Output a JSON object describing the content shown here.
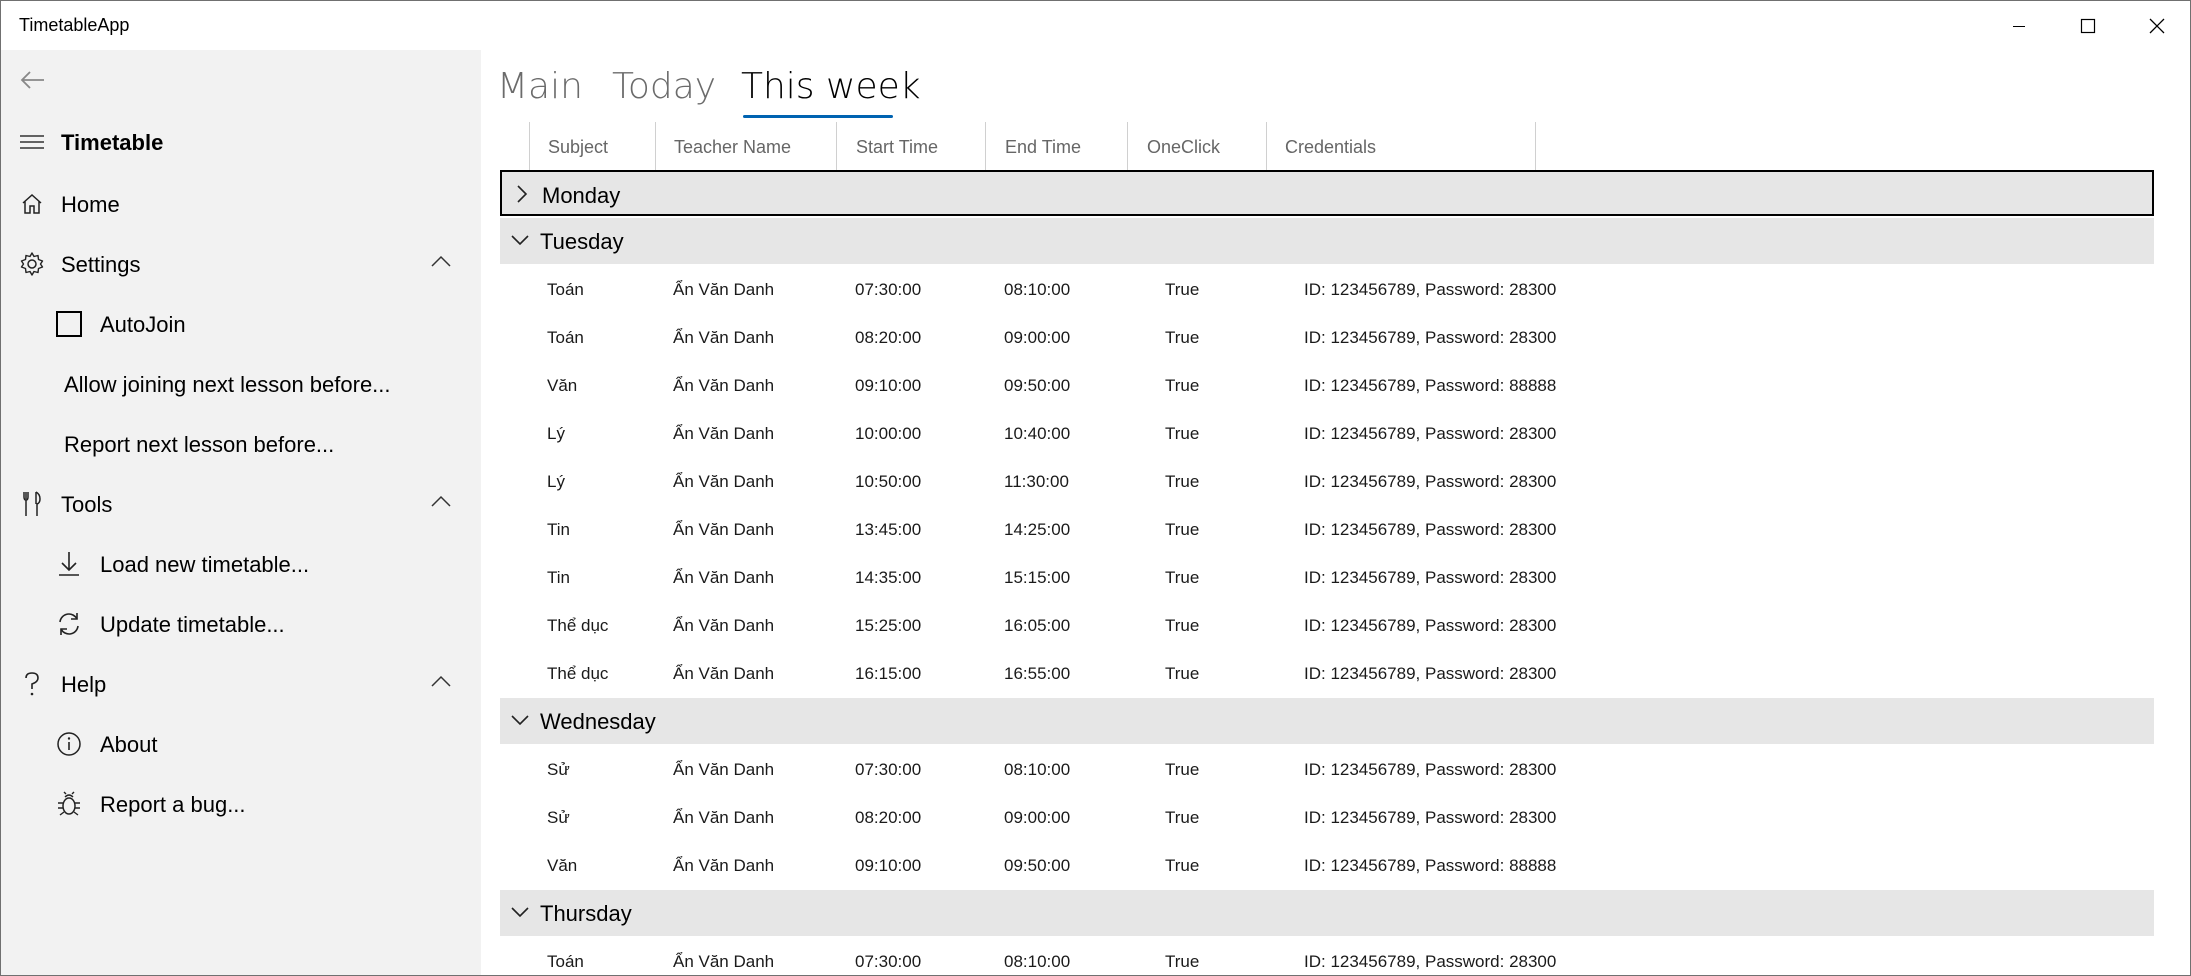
{
  "window": {
    "title": "TimetableApp"
  },
  "sidebar": {
    "title": "Timetable",
    "home": "Home",
    "settings": {
      "label": "Settings",
      "autojoin": "AutoJoin",
      "allow_joining": "Allow joining next lesson before...",
      "report_next": "Report next lesson before..."
    },
    "tools": {
      "label": "Tools",
      "load": "Load new timetable...",
      "update": "Update timetable..."
    },
    "help": {
      "label": "Help",
      "about": "About",
      "report_bug": "Report a bug..."
    }
  },
  "tabs": {
    "main": "Main",
    "today": "Today",
    "this_week": "This week",
    "selected": "This week"
  },
  "columns": {
    "subject": "Subject",
    "teacher": "Teacher Name",
    "start": "Start Time",
    "end": "End Time",
    "oneclick": "OneClick",
    "credentials": "Credentials"
  },
  "groups": {
    "monday": {
      "day": "Monday",
      "expanded": false,
      "rows": []
    },
    "tuesday": {
      "day": "Tuesday",
      "expanded": true,
      "rows": [
        {
          "subject": "Toán",
          "teacher": "Ẩn Văn Danh",
          "start": "07:30:00",
          "end": "08:10:00",
          "oneclick": "True",
          "credentials": "ID: 123456789, Password: 28300"
        },
        {
          "subject": "Toán",
          "teacher": "Ẩn Văn Danh",
          "start": "08:20:00",
          "end": "09:00:00",
          "oneclick": "True",
          "credentials": "ID: 123456789, Password: 28300"
        },
        {
          "subject": "Văn",
          "teacher": "Ẩn Văn Danh",
          "start": "09:10:00",
          "end": "09:50:00",
          "oneclick": "True",
          "credentials": "ID: 123456789, Password: 88888"
        },
        {
          "subject": "Lý",
          "teacher": "Ẩn Văn Danh",
          "start": "10:00:00",
          "end": "10:40:00",
          "oneclick": "True",
          "credentials": "ID: 123456789, Password: 28300"
        },
        {
          "subject": "Lý",
          "teacher": "Ẩn Văn Danh",
          "start": "10:50:00",
          "end": "11:30:00",
          "oneclick": "True",
          "credentials": "ID: 123456789, Password: 28300"
        },
        {
          "subject": "Tin",
          "teacher": "Ẩn Văn Danh",
          "start": "13:45:00",
          "end": "14:25:00",
          "oneclick": "True",
          "credentials": "ID: 123456789, Password: 28300"
        },
        {
          "subject": "Tin",
          "teacher": "Ẩn Văn Danh",
          "start": "14:35:00",
          "end": "15:15:00",
          "oneclick": "True",
          "credentials": "ID: 123456789, Password: 28300"
        },
        {
          "subject": "Thể dục",
          "teacher": "Ẩn Văn Danh",
          "start": "15:25:00",
          "end": "16:05:00",
          "oneclick": "True",
          "credentials": "ID: 123456789, Password: 28300"
        },
        {
          "subject": "Thể dục",
          "teacher": "Ẩn Văn Danh",
          "start": "16:15:00",
          "end": "16:55:00",
          "oneclick": "True",
          "credentials": "ID: 123456789, Password: 28300"
        }
      ]
    },
    "wednesday": {
      "day": "Wednesday",
      "expanded": true,
      "rows": [
        {
          "subject": "Sử",
          "teacher": "Ẩn Văn Danh",
          "start": "07:30:00",
          "end": "08:10:00",
          "oneclick": "True",
          "credentials": "ID: 123456789, Password: 28300"
        },
        {
          "subject": "Sử",
          "teacher": "Ẩn Văn Danh",
          "start": "08:20:00",
          "end": "09:00:00",
          "oneclick": "True",
          "credentials": "ID: 123456789, Password: 28300"
        },
        {
          "subject": "Văn",
          "teacher": "Ẩn Văn Danh",
          "start": "09:10:00",
          "end": "09:50:00",
          "oneclick": "True",
          "credentials": "ID: 123456789, Password: 88888"
        }
      ]
    },
    "thursday": {
      "day": "Thursday",
      "expanded": true,
      "rows": [
        {
          "subject": "Toán",
          "teacher": "Ẩn Văn Danh",
          "start": "07:30:00",
          "end": "08:10:00",
          "oneclick": "True",
          "credentials": "ID: 123456789, Password: 28300"
        }
      ]
    }
  }
}
